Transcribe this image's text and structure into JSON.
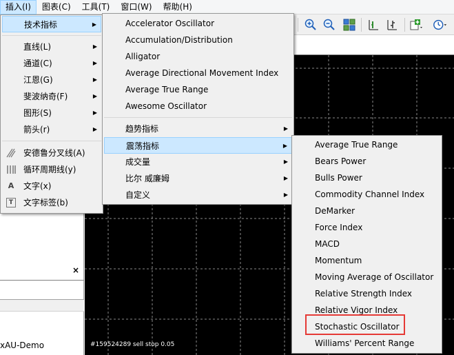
{
  "menubar": {
    "items": [
      {
        "label": "插入(I)"
      },
      {
        "label": "图表(C)"
      },
      {
        "label": "工具(T)"
      },
      {
        "label": "窗口(W)"
      },
      {
        "label": "帮助(H)"
      }
    ]
  },
  "insert_menu": {
    "items": [
      {
        "label": "技术指标"
      },
      {
        "label": "直线(L)"
      },
      {
        "label": "通道(C)"
      },
      {
        "label": "江恩(G)"
      },
      {
        "label": "斐波纳奇(F)"
      },
      {
        "label": "图形(S)"
      },
      {
        "label": "箭头(r)"
      },
      {
        "label": "安德鲁分叉线(A)"
      },
      {
        "label": "循环周期线(y)"
      },
      {
        "label": "文字(x)",
        "icon_glyph": "A"
      },
      {
        "label": "文字标签(b)",
        "icon_glyph": "T"
      }
    ]
  },
  "indicators_menu": {
    "items": [
      {
        "label": "Accelerator Oscillator"
      },
      {
        "label": "Accumulation/Distribution"
      },
      {
        "label": "Alligator"
      },
      {
        "label": "Average Directional Movement Index"
      },
      {
        "label": "Average True Range"
      },
      {
        "label": "Awesome Oscillator"
      },
      {
        "label": "趋势指标"
      },
      {
        "label": "震荡指标"
      },
      {
        "label": "成交量"
      },
      {
        "label": "比尔 威廉姆"
      },
      {
        "label": "自定义"
      }
    ]
  },
  "oscillators_menu": {
    "items": [
      {
        "label": "Average True Range"
      },
      {
        "label": "Bears Power"
      },
      {
        "label": "Bulls Power"
      },
      {
        "label": "Commodity Channel Index"
      },
      {
        "label": "DeMarker"
      },
      {
        "label": "Force Index"
      },
      {
        "label": "MACD"
      },
      {
        "label": "Momentum"
      },
      {
        "label": "Moving Average of Oscillator"
      },
      {
        "label": "Relative Strength Index"
      },
      {
        "label": "Relative Vigor Index"
      },
      {
        "label": "Stochastic Oscillator"
      },
      {
        "label": "Williams' Percent Range"
      }
    ]
  },
  "left_panel": {
    "close_glyph": "×",
    "account_text": "xAU-Demo"
  },
  "chart": {
    "status_text": "#159524289 sell stop 0.05"
  },
  "colors": {
    "highlight_box": "#e53935",
    "menu_hover": "#cce8ff",
    "chart_bg": "#000000"
  }
}
